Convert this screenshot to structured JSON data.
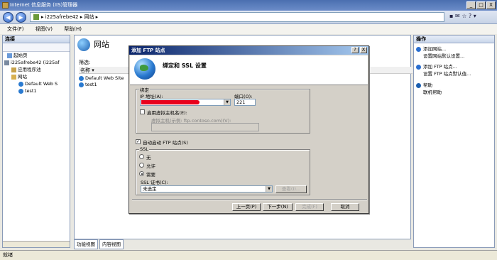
{
  "window": {
    "title": "Internet 信息服务 (IIS)管理器",
    "min": "_",
    "max": "□",
    "close": "X"
  },
  "address": {
    "back": "◀",
    "forward": "▶",
    "crumbs": "▸ i225afrebe42 ▸ 网站 ▸",
    "tools": "▪ ✉ ☆ ? ▾"
  },
  "menu": {
    "file": "文件(F)",
    "view": "视图(V)",
    "help": "帮助(H)"
  },
  "connections": {
    "title": "连接",
    "tree": [
      "起始页",
      "i225afrebe42 (i225af",
      "应用程序池",
      "网站",
      "Default Web S",
      "test1"
    ]
  },
  "main": {
    "title": "网站",
    "filter": "筛选:",
    "col_name": "名称 ▾",
    "rows": [
      "Default Web Site",
      "test1"
    ]
  },
  "view_tabs": {
    "features": "功能视图",
    "content": "内容视图"
  },
  "actions": {
    "title": "操作",
    "add_site": "添加网站...",
    "site_defaults": "设置网站默认设置...",
    "add_ftp": "添加 FTP 站点...",
    "ftp_defaults": "设置 FTP 站点默认值...",
    "help": "帮助",
    "online_help": "联机帮助"
  },
  "status": {
    "text": "就绪"
  },
  "dialog": {
    "title": "添加 FTP 站点",
    "help_btn": "?",
    "close_btn": "X",
    "heading": "绑定和 SSL 设置",
    "binding_group": "绑定",
    "ip_label": "IP 地址(A):",
    "ip_value": "",
    "port_label": "端口(O):",
    "port_value": "221",
    "vhost_check": "启用虚拟主机名(E):",
    "vhost_label": "虚拟主机(示例: ftp.contoso.com)(V):",
    "vhost_value": "",
    "autostart": "自动启动 FTP 站点(S)",
    "ssl_group": "SSL",
    "ssl_none": "无",
    "ssl_allow": "允许",
    "ssl_require": "需要",
    "ssl_cert_label": "SSL 证书(C):",
    "ssl_cert_value": "未选定",
    "view_btn": "查看(I)...",
    "prev_btn": "上一页(P)",
    "next_btn": "下一步(N)",
    "finish_btn": "完成(F)",
    "cancel_btn": "取消"
  }
}
